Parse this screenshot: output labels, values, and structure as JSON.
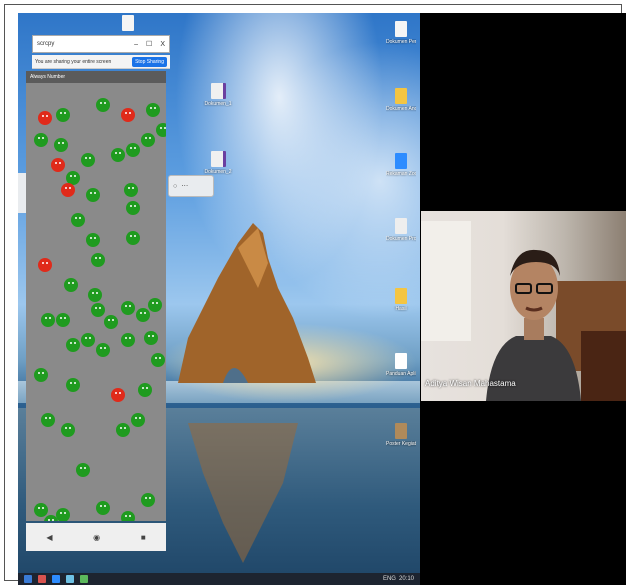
{
  "mini_window": {
    "title": "scrcpy",
    "minimize": "–",
    "maximize": "☐",
    "close": "X"
  },
  "share_bar": {
    "message": "You are sharing your entire screen",
    "stop_button": "Stop Sharing"
  },
  "game": {
    "header_text": "Always Number"
  },
  "navbar": {
    "back": "◀",
    "home": "◉",
    "recent": "■"
  },
  "browser_snip": {
    "icon1": "○",
    "icon2": "⋯"
  },
  "desktop_icons": [
    {
      "label": "Dokumen Pengguna"
    },
    {
      "label": "Dokumen Anda"
    },
    {
      "label": "Rekaman Zoom"
    },
    {
      "label": "Dokumen Program"
    },
    {
      "label": "Hasil"
    },
    {
      "label": "Panduan Aplikasi"
    },
    {
      "label": "Poster Kegiatan"
    },
    {
      "label": "Dokumen_1"
    },
    {
      "label": "Dokumen_2"
    }
  ],
  "video": {
    "participant_name": "Aditya Wisan Mahastama"
  },
  "tray": {
    "time": "20:10",
    "notif": "ENG"
  },
  "colors": {
    "ball_green": "#1f9b1f",
    "ball_red": "#e02a1a",
    "game_bg": "#8a8a8a",
    "taskbar": "#1d2430"
  }
}
